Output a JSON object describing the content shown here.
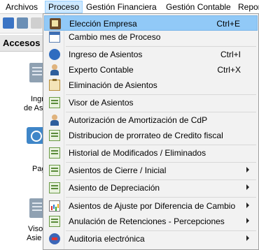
{
  "menubar": {
    "items": [
      {
        "label": "Archivos",
        "mnemonic": "A"
      },
      {
        "label": "Proceso",
        "mnemonic": "P"
      },
      {
        "label": "Gestión Financiera",
        "mnemonic": "G"
      },
      {
        "label": "Gestión Contable",
        "mnemonic": "G"
      },
      {
        "label": "Repor"
      }
    ]
  },
  "sidebar": {
    "header": "Accesos",
    "items": [
      {
        "label_1": "Ingr",
        "label_2": "de As"
      },
      {
        "label_1": "Pag"
      },
      {
        "label_1": "Viso",
        "label_2": "Asie"
      }
    ]
  },
  "menu": {
    "items": [
      {
        "label": "Elección Empresa",
        "shortcut": "Ctrl+E",
        "icon": "book-icon",
        "highlighted": true
      },
      {
        "label": "Cambio mes de Proceso",
        "shortcut": "",
        "icon": "calendar-icon"
      },
      {
        "label": "Ingreso de Asientos",
        "shortcut": "Ctrl+I",
        "icon": "globe-icon"
      },
      {
        "label": "Experto Contable",
        "shortcut": "Ctrl+X",
        "icon": "expert-icon"
      },
      {
        "label": "Eliminación de Asientos",
        "shortcut": "",
        "icon": "clipboard-icon"
      },
      {
        "label": "Visor de Asientos",
        "shortcut": "",
        "icon": "screen-icon"
      },
      {
        "label": "Autorización de Amortización de CdP",
        "shortcut": "",
        "icon": "person-icon"
      },
      {
        "label": "Distribucion de prorrateo de Credito fiscal",
        "shortcut": "",
        "icon": "screen-icon"
      },
      {
        "label": "Historial de Modificados / Eliminados",
        "shortcut": "",
        "icon": "screen-icon"
      },
      {
        "label": "Asientos de Cierre / Inicial",
        "shortcut": "",
        "icon": "screen-icon",
        "submenu": true
      },
      {
        "label": "Asiento de Depreciación",
        "shortcut": "",
        "icon": "screen-icon",
        "submenu": true
      },
      {
        "label": "Asientos de Ajuste por Diferencia de Cambio",
        "shortcut": "",
        "icon": "chart-icon",
        "submenu": true
      },
      {
        "label": "Anulación de Retenciones - Percepciones",
        "shortcut": "",
        "icon": "screen-icon",
        "submenu": true
      },
      {
        "label": "Auditoria electrónica",
        "shortcut": "",
        "icon": "audit-icon",
        "submenu": true
      }
    ]
  }
}
